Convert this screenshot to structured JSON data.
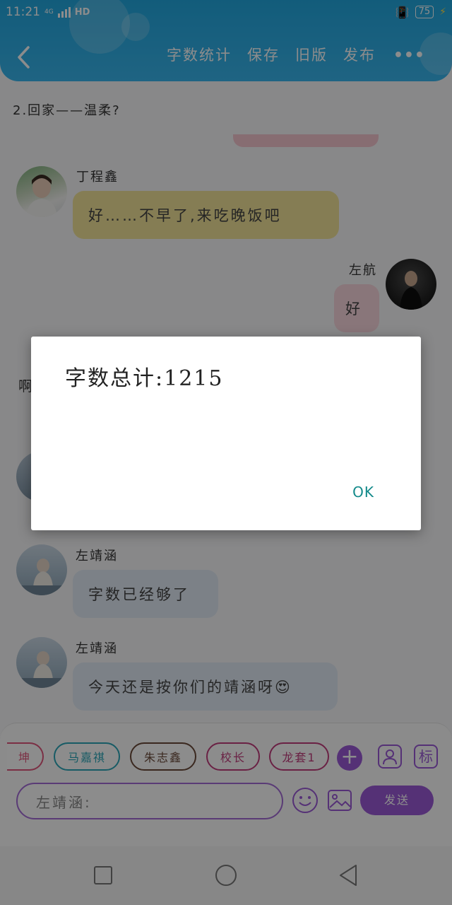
{
  "status_bar": {
    "time": "11:21",
    "network": "4G",
    "hd": "HD",
    "battery": "75"
  },
  "header": {
    "menu": [
      "字数统计",
      "保存",
      "旧版",
      "发布"
    ],
    "more": "•••"
  },
  "chat": {
    "chapter_title": "2.回家——温柔?",
    "messages": [
      {
        "name": "丁程鑫",
        "text": "好……不早了,来吃晚饭吧",
        "side": "left",
        "color": "#f3e49a"
      },
      {
        "name": "左航",
        "text": "好",
        "side": "right",
        "color": "#f9d7de"
      },
      {
        "name": "左靖涵",
        "text": "字数已经够了",
        "side": "left",
        "color": "#e2ebf6"
      },
      {
        "name": "左靖涵",
        "text": "今天还是按你们的靖涵呀😍",
        "side": "left",
        "color": "#e2ebf6"
      }
    ],
    "partial_text": "啊"
  },
  "characters": [
    "坤",
    "马嘉祺",
    "朱志鑫",
    "校长",
    "龙套1"
  ],
  "toolbar_icons": [
    "contact-icon",
    "tag-icon"
  ],
  "tag_icon_text": "标",
  "input": {
    "value": "左靖涵:"
  },
  "send_label": "发送",
  "dialog": {
    "message": "字数总计:1215",
    "ok": "OK"
  },
  "colors": {
    "header": "#2aaee6",
    "accent": "#9b5ad8"
  }
}
